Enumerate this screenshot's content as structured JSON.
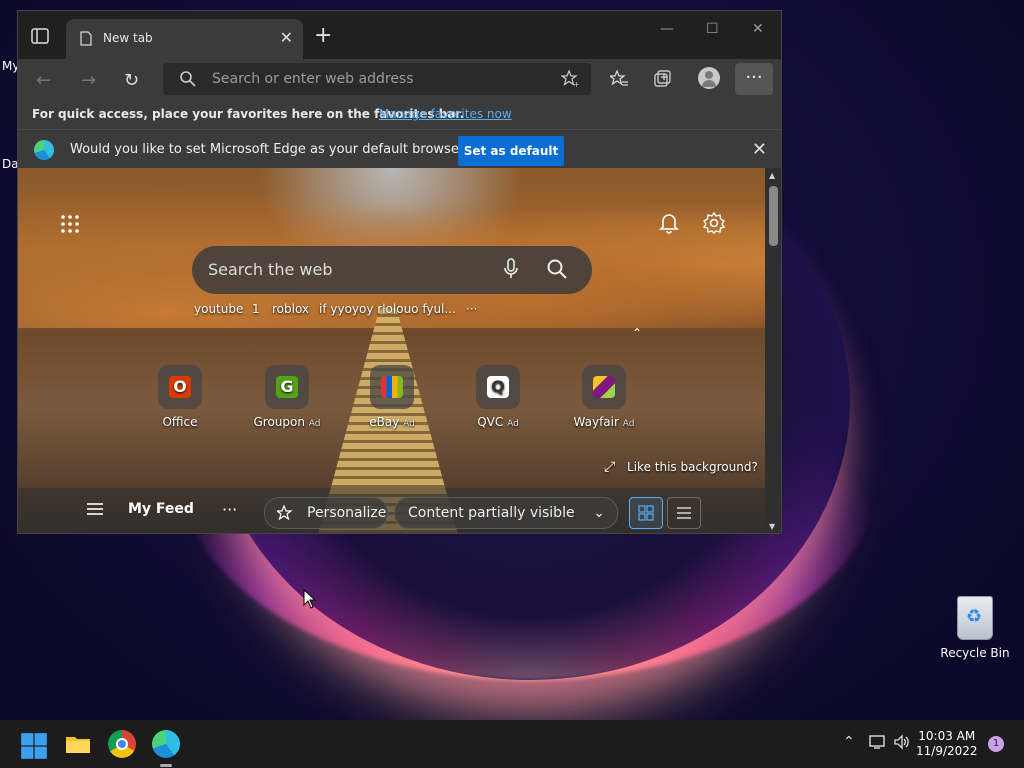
{
  "desktop": {
    "edge_texts": [
      "My",
      "Da"
    ],
    "recycle_bin_label": "Recycle Bin"
  },
  "browser": {
    "tab": {
      "title": "New tab"
    },
    "address_bar": {
      "placeholder": "Search or enter web address"
    },
    "favorites_bar": {
      "message": "For quick access, place your favorites here on the favorites bar.",
      "link": "Manage favorites now"
    },
    "default_prompt": {
      "question": "Would you like to set Microsoft Edge as your default browser?",
      "button": "Set as default"
    },
    "more_label": "···"
  },
  "new_tab_page": {
    "search_placeholder": "Search the web",
    "recent_searches": [
      "youtube",
      "1",
      "roblox",
      "if yyoyoy rlolouo fyul...",
      "···"
    ],
    "tiles": [
      {
        "label": "Office",
        "ad": ""
      },
      {
        "label": "Groupon",
        "ad": "Ad"
      },
      {
        "label": "eBay",
        "ad": "Ad"
      },
      {
        "label": "QVC",
        "ad": "Ad"
      },
      {
        "label": "Wayfair",
        "ad": "Ad"
      }
    ],
    "like_background": "Like this background?",
    "feed": {
      "my_feed": "My Feed",
      "dots": "···",
      "personalize": "Personalize",
      "content_visibility": "Content partially visible"
    }
  },
  "taskbar": {
    "time": "10:03 AM",
    "date": "11/9/2022",
    "notification_count": "1"
  },
  "colors": {
    "edge_blue": "#0b6ed4",
    "link_blue": "#5aaef3"
  }
}
